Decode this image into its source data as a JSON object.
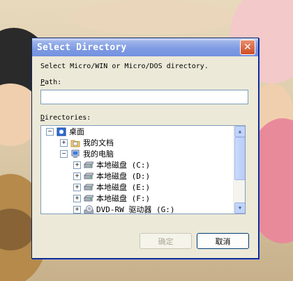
{
  "window": {
    "title": "Select Directory"
  },
  "instructions": "Select Micro/WIN or Micro/DOS directory.",
  "path_field": {
    "label_underlined": "P",
    "label_rest": "ath:",
    "value": ""
  },
  "directories_label_underlined": "D",
  "directories_label_rest": "irectories:",
  "tree": [
    {
      "label": "桌面",
      "expander": "−",
      "icon": "desktop-icon"
    },
    {
      "label": "我的文档",
      "expander": "+",
      "icon": "my-documents-folder-icon"
    },
    {
      "label": "我的电脑",
      "expander": "−",
      "icon": "my-computer-icon"
    },
    {
      "label": "本地磁盘 (C:)",
      "expander": "+",
      "icon": "local-disk-icon"
    },
    {
      "label": "本地磁盘 (D:)",
      "expander": "+",
      "icon": "local-disk-icon"
    },
    {
      "label": "本地磁盘 (E:)",
      "expander": "+",
      "icon": "local-disk-icon"
    },
    {
      "label": "本地磁盘 (F:)",
      "expander": "+",
      "icon": "local-disk-icon"
    },
    {
      "label": "DVD-RW 驱动器 (G:)",
      "expander": "+",
      "icon": "dvd-drive-icon"
    }
  ],
  "buttons": {
    "ok_label": "确定",
    "cancel_label": "取消"
  },
  "colors": {
    "title_bar": "#7d9ae2",
    "dialog_bg": "#ece9d8",
    "close_button": "#cf4b22"
  }
}
